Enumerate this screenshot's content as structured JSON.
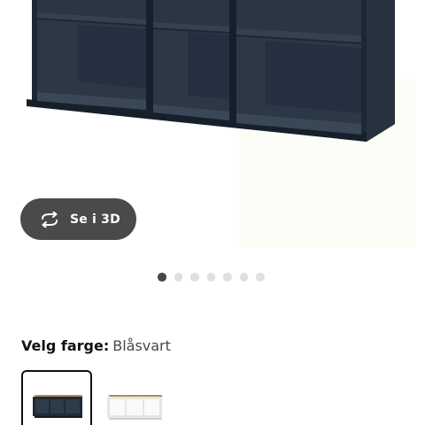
{
  "gallery": {
    "view_3d_label": "Se i 3D",
    "view_3d_icon": "rotate-3d-icon",
    "dot_count": 7,
    "active_dot": 1
  },
  "colors": {
    "heading_key": "Velg farge:",
    "selected_value": "Blåsvart",
    "options": [
      {
        "name": "blue-black",
        "color": "#1e2a36",
        "selected": true
      },
      {
        "name": "white",
        "color": "#f5f5f5",
        "selected": false
      }
    ]
  }
}
